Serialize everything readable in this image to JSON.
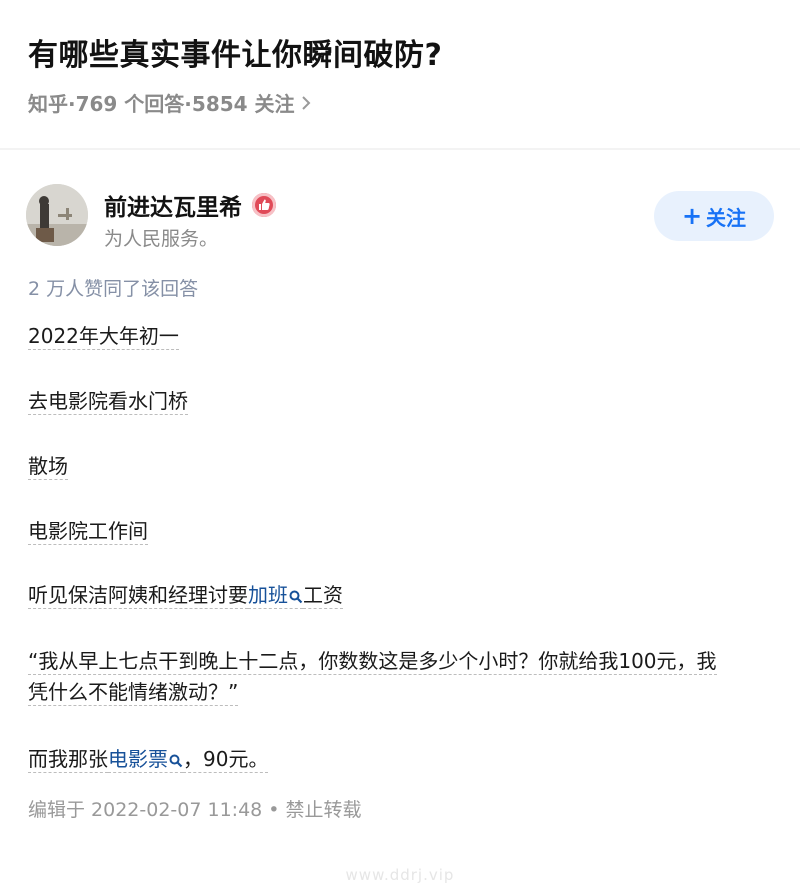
{
  "question": {
    "title": "有哪些真实事件让你瞬间破防?",
    "meta": "知乎·769 个回答·5854 关注",
    "meta_chevron_icon": "chevron-right-icon"
  },
  "author": {
    "name": "前进达瓦里希",
    "bio": "为人民服务。",
    "badge_icon": "thumbs-up-badge-icon",
    "avatar_icon": "avatar-statue-image",
    "follow_label": "关注",
    "follow_plus": "+"
  },
  "answer": {
    "likes": "2 万人赞同了该回答",
    "p1": "2022年大年初一",
    "p2": "去电影院看水门桥",
    "p3": "散场",
    "p4": "电影院工作间",
    "p5_pre": "听见保洁阿姨和经理讨要",
    "p5_kw": "加班",
    "p5_post": "工资",
    "p6_line1": "“我从早上七点干到晚上十二点，你数数这是多少个小时？你就给我100元，我",
    "p6_line2": "凭什么不能情绪激动？”",
    "p7_pre": "而我那张",
    "p7_kw": "电影票",
    "p7_post": "，90元。",
    "footer": "编辑于 2022-02-07 11:48 • 禁止转载",
    "search_icon": "search-icon"
  },
  "watermark": "www.ddrj.vip",
  "colors": {
    "accent": "#1772f6",
    "follow_bg": "#e8f1fd",
    "keyword": "#175199",
    "meta_gray": "#8a8a8a",
    "likes_gray": "#8590a6",
    "badge_red": "#e04a58"
  }
}
